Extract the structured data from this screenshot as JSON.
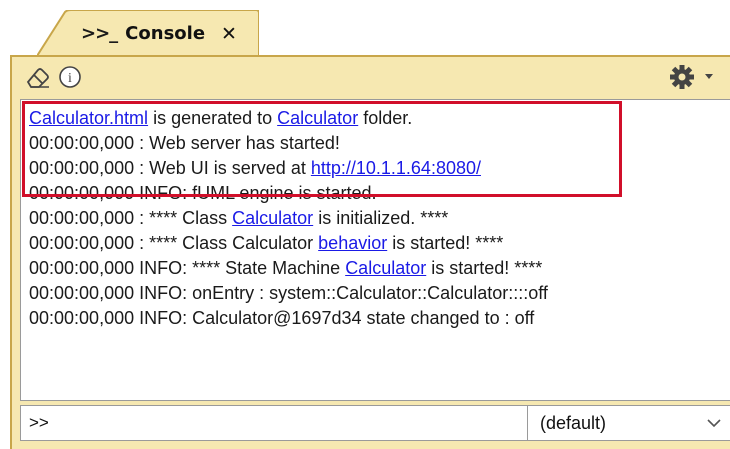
{
  "tab": {
    "icon_text": ">>_",
    "title": "Console",
    "close": "✕"
  },
  "toolbar": {
    "clear_icon": "eraser-icon",
    "info_icon": "info-icon",
    "settings_icon": "gear-icon",
    "dropdown_icon": "chevron-down-icon"
  },
  "console": {
    "lines": [
      [
        {
          "t": "Calculator.html",
          "link": true
        },
        {
          "t": " is generated to "
        },
        {
          "t": "Calculator",
          "link": true
        },
        {
          "t": " folder."
        }
      ],
      [
        {
          "t": "00:00:00,000 : Web server has started!"
        }
      ],
      [
        {
          "t": "00:00:00,000 : Web UI is served at "
        },
        {
          "t": "http://10.1.1.64:8080/",
          "link": true
        }
      ],
      [
        {
          "t": "00:00:00,000 INFO: fUML engine is started."
        }
      ],
      [
        {
          "t": "00:00:00,000 : **** Class "
        },
        {
          "t": "Calculator",
          "link": true
        },
        {
          "t": " is initialized. ****"
        }
      ],
      [
        {
          "t": "00:00:00,000 : **** Class Calculator "
        },
        {
          "t": "behavior",
          "link": true
        },
        {
          "t": " is started! ****"
        }
      ],
      [
        {
          "t": "00:00:00,000 INFO: **** State Machine "
        },
        {
          "t": "Calculator",
          "link": true
        },
        {
          "t": " is started! ****"
        }
      ],
      [
        {
          "t": "00:00:00,000 INFO: onEntry : system::Calculator::Calculator::::off"
        }
      ],
      [
        {
          "t": "00:00:00,000 INFO: Calculator@1697d34 state changed to : off"
        }
      ]
    ]
  },
  "command": {
    "prompt": ">>",
    "select_value": "(default)"
  },
  "colors": {
    "panel_bg": "#f6e8b1",
    "link": "#1a1ae6",
    "highlight_border": "#d10f2a"
  }
}
